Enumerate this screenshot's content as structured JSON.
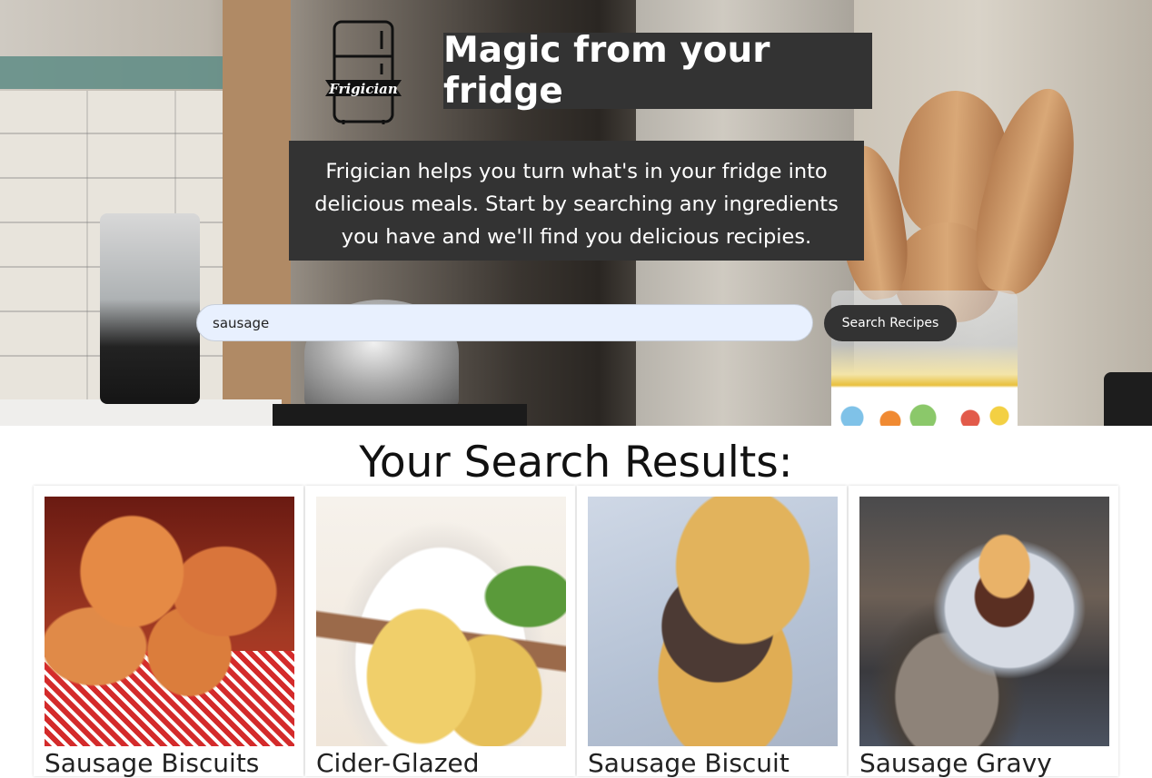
{
  "hero": {
    "logo_text": "Frigician",
    "headline": "Magic from your fridge",
    "blurb": "Frigician helps you turn what's in your fridge into delicious meals. Start by searching any ingredients you have and we'll find you delicious recipies.",
    "search": {
      "value": "sausage",
      "placeholder": ""
    },
    "search_button": "Search Recipes"
  },
  "results": {
    "title": "Your Search Results:",
    "cards": [
      {
        "name": "Sausage Biscuits"
      },
      {
        "name": "Cider-Glazed"
      },
      {
        "name": "Sausage Biscuit"
      },
      {
        "name": "Sausage Gravy"
      }
    ]
  }
}
